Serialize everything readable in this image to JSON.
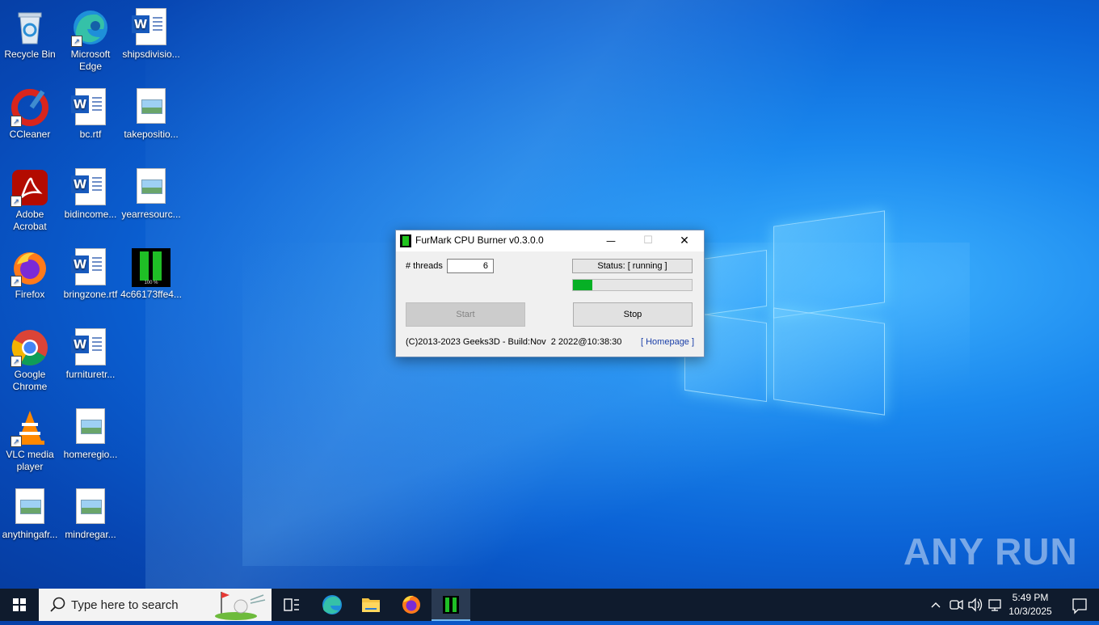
{
  "desktop": {
    "icons": [
      {
        "label": "Recycle Bin"
      },
      {
        "label": "Microsoft Edge"
      },
      {
        "label": "shipsdivisio..."
      },
      {
        "label": "CCleaner"
      },
      {
        "label": "bc.rtf"
      },
      {
        "label": "takepositio..."
      },
      {
        "label": "Adobe Acrobat"
      },
      {
        "label": "bidincome..."
      },
      {
        "label": "yearresourc..."
      },
      {
        "label": "Firefox"
      },
      {
        "label": "bringzone.rtf"
      },
      {
        "label": "4c66173ffe4..."
      },
      {
        "label": "Google Chrome"
      },
      {
        "label": "furnituretr..."
      },
      {
        "label": "VLC media player"
      },
      {
        "label": "homeregio..."
      },
      {
        "label": "anythingafr..."
      },
      {
        "label": "mindregar..."
      }
    ],
    "furmark_thumb_text": "100 %"
  },
  "dialog": {
    "title": "FurMark CPU Burner v0.3.0.0",
    "threads_label": "# threads",
    "threads_value": "6",
    "status_text": "Status: [ running ]",
    "progress_fraction": 0.16,
    "start_label": "Start",
    "stop_label": "Stop",
    "footer": "(C)2013-2023 Geeks3D - Build:Nov  2 2022@10:38:30",
    "homepage_link": "[ Homepage ]",
    "minimize_glyph": "—",
    "maximize_glyph": "☐",
    "close_glyph": "✕"
  },
  "taskbar": {
    "search_placeholder": "Type here to search",
    "time": "5:49 PM",
    "date": "10/3/2025"
  },
  "watermark": "ANY RUN",
  "colors": {
    "progress_fill": "#06b025",
    "taskbar_bg": "#0f1b2d",
    "link": "#1a3fa8"
  }
}
